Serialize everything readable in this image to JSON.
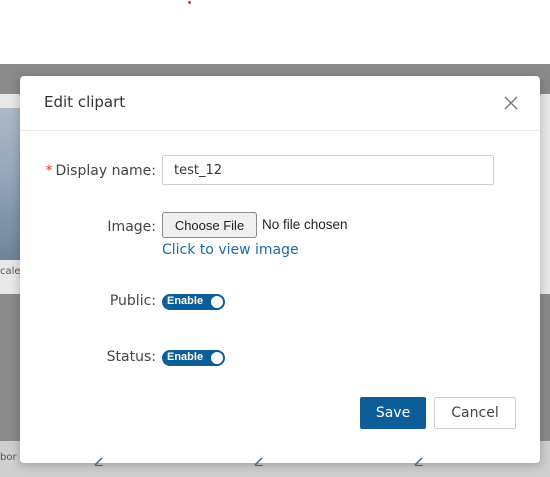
{
  "background": {
    "left_caption": "cale",
    "bottom_caption": "bor"
  },
  "dialog": {
    "title": "Edit clipart",
    "fields": {
      "display_name_label": "Display name",
      "display_name_required_mark": "*",
      "display_name_value": "test_12",
      "image_label": "Image",
      "choose_file_label": "Choose File",
      "file_status": "No file chosen",
      "view_image_link": "Click to view image",
      "public_label": "Public",
      "public_toggle": "Enable",
      "status_label": "Status",
      "status_toggle": "Enable",
      "label_separator": ":"
    },
    "buttons": {
      "save": "Save",
      "cancel": "Cancel"
    }
  },
  "colors": {
    "accent": "#0d5d99",
    "link": "#1b6aa5",
    "required": "#e0342f",
    "overlay": "#8a8a8a"
  },
  "icons": {
    "close": "close-icon",
    "edit_link": "edit-icon"
  }
}
